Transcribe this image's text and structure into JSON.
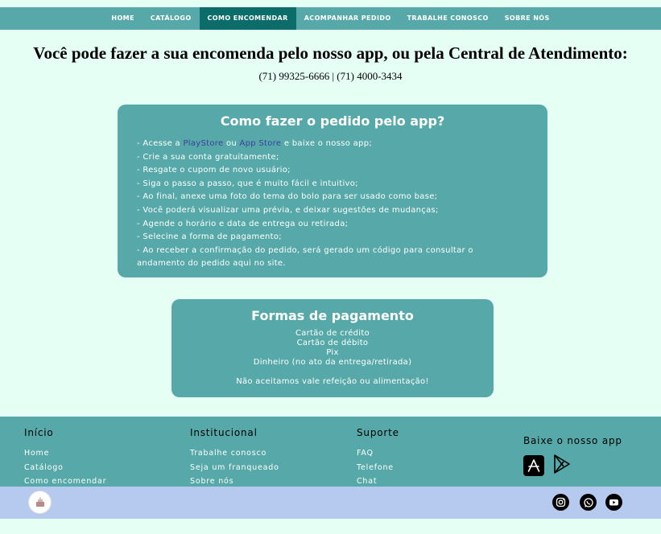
{
  "nav": {
    "items": [
      {
        "label": "HOME"
      },
      {
        "label": "CATÁLOGO"
      },
      {
        "label": "COMO ENCOMENDAR"
      },
      {
        "label": "ACOMPANHAR PEDIDO"
      },
      {
        "label": "TRABALHE CONOSCO"
      },
      {
        "label": "SOBRE NÓS"
      }
    ],
    "active_index": 2
  },
  "main": {
    "headline": "Você pode fazer a sua encomenda pelo nosso app, ou pela Central de Atendimento:",
    "phones": "(71) 99325-6666 | (71) 4000-3434"
  },
  "app_card": {
    "title": "Como fazer o pedido pelo app?",
    "step1_prefix": "- Acesse a ",
    "playstore_link": "PlayStore",
    "step1_mid": " ou ",
    "appstore_link": "App Store",
    "step1_suffix": " e baixe o nosso app;",
    "steps": [
      "- Crie a sua conta gratuitamente;",
      "- Resgate o cupom de novo usuário;",
      "- Siga o passo a passo, que é muito fácil e intuitivo;",
      "- Ao final, anexe uma foto do tema do bolo para ser usado como base;",
      "- Você poderá visualizar uma prévia, e deixar sugestões de mudanças;",
      "- Agende o horário e data de entrega ou retirada;",
      "- Selecine a forma de pagamento;",
      "- Ao receber a confirmação do pedido, será gerado um código para consultar o andamento do pedido aqui no site."
    ]
  },
  "payment_card": {
    "title": "Formas de pagamento",
    "methods": [
      "Cartão de crédito",
      "Cartão de débito",
      "Pix",
      "Dinheiro (no ato da entrega/retirada)"
    ],
    "note": "Não aceitamos vale refeição ou alimentação!"
  },
  "footer": {
    "inicio": {
      "title": "Início",
      "links": [
        "Home",
        "Catálogo",
        "Como encomendar"
      ]
    },
    "institucional": {
      "title": "Institucional",
      "links": [
        "Trabalhe conosco",
        "Seja um franqueado",
        "Sobre nós"
      ]
    },
    "suporte": {
      "title": "Suporte",
      "links": [
        "FAQ",
        "Telefone",
        "Chat"
      ]
    },
    "app": {
      "title": "Baixe o nosso app",
      "icons": [
        "app-store-icon",
        "play-store-icon"
      ]
    }
  },
  "bottombar": {
    "social_icons": [
      "instagram-icon",
      "whatsapp-icon",
      "youtube-icon"
    ]
  },
  "colors": {
    "teal": "#56a9a8",
    "nav_active": "#0c6c6a",
    "background": "#e6fff4",
    "bottombar": "#b6caf0",
    "link": "#3b3f9e"
  }
}
